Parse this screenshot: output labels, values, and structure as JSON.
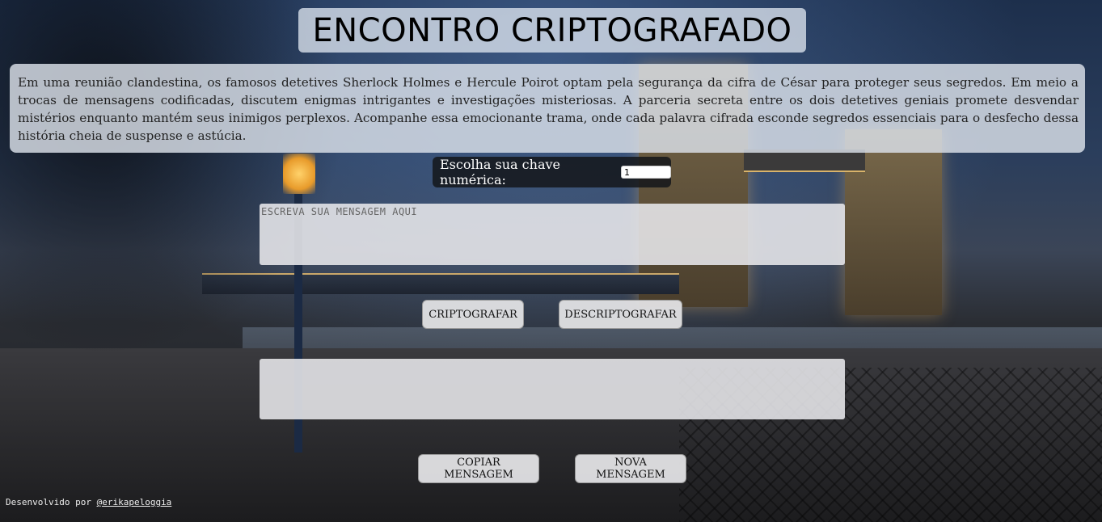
{
  "header": {
    "title": "ENCONTRO CRIPTOGRAFADO"
  },
  "intro": {
    "text": "Em uma reunião clandestina, os famosos detetives Sherlock Holmes e Hercule Poirot optam pela segurança da cifra de César para proteger seus segredos. Em meio a trocas de mensagens codificadas, discutem enigmas intrigantes e investigações misteriosas. A parceria secreta entre os dois detetives geniais promete desvendar mistérios enquanto mantém seus inimigos perplexos. Acompanhe essa emocionante trama, onde cada palavra cifrada esconde segredos essenciais para o desfecho dessa história cheia de suspense e astúcia."
  },
  "key": {
    "label": "Escolha sua chave numérica:",
    "value": "1"
  },
  "message": {
    "placeholder": "ESCREVA SUA MENSAGEM AQUI",
    "value": ""
  },
  "result": {
    "value": ""
  },
  "buttons": {
    "encrypt": "CRIPTOGRAFAR",
    "decrypt": "DESCRIPTOGRAFAR",
    "copy": "COPIAR MENSAGEM",
    "new": "NOVA MENSAGEM"
  },
  "footer": {
    "prefix": "Desenvolvido por",
    "author_link": "@erikapeloggia"
  }
}
